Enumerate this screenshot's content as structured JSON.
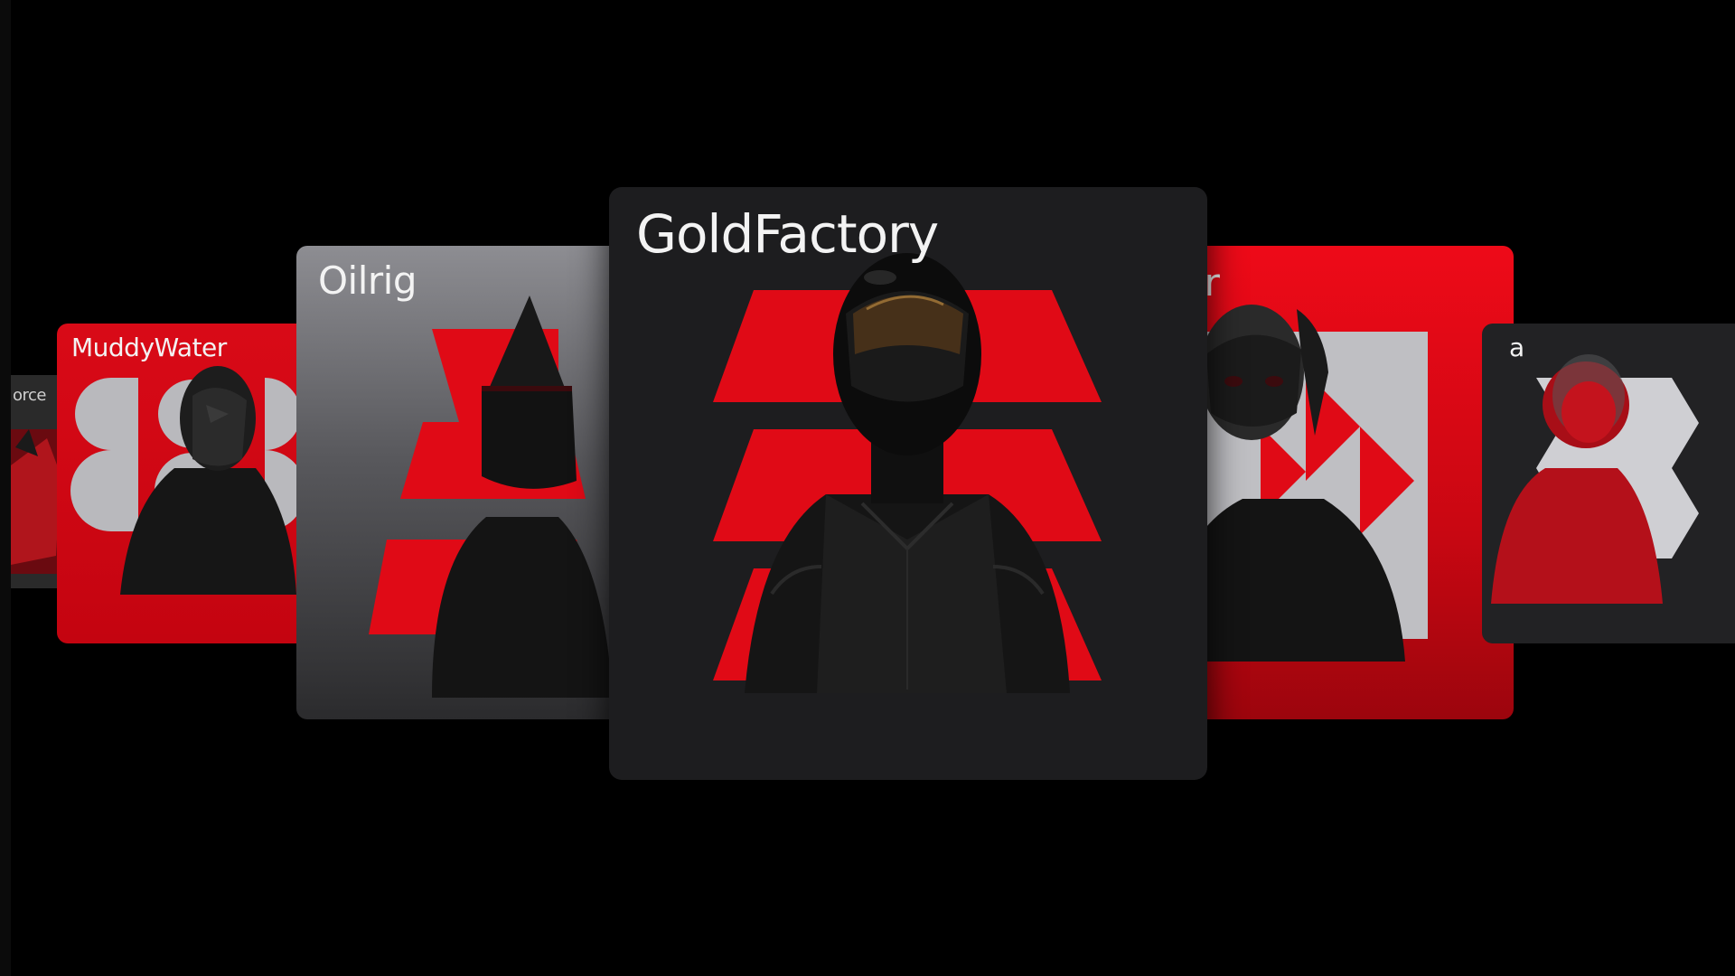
{
  "carousel": {
    "cards": [
      {
        "id": "force",
        "title": "orce"
      },
      {
        "id": "muddywater",
        "title": "MuddyWater"
      },
      {
        "id": "oilrig",
        "title": "Oilrig"
      },
      {
        "id": "goldfactory",
        "title": "GoldFactory"
      },
      {
        "id": "cipher",
        "title": "pher"
      },
      {
        "id": "right",
        "title": "a"
      }
    ],
    "active_index": 3
  },
  "colors": {
    "background": "#000000",
    "accent_red": "#e00a16",
    "card_dark": "#1d1d1f",
    "card_gray": "#8d8d92",
    "text": "#f3f3f3"
  },
  "icons": {
    "goldfactory_logo": "red-stacked-trapezoids",
    "oilrig_logo": "red-triangle-stripes",
    "muddywater_logo": "gray-circle-pattern",
    "cipher_logo": "gray-chevron-pattern",
    "right_logo": "gray-chevron-pattern"
  }
}
